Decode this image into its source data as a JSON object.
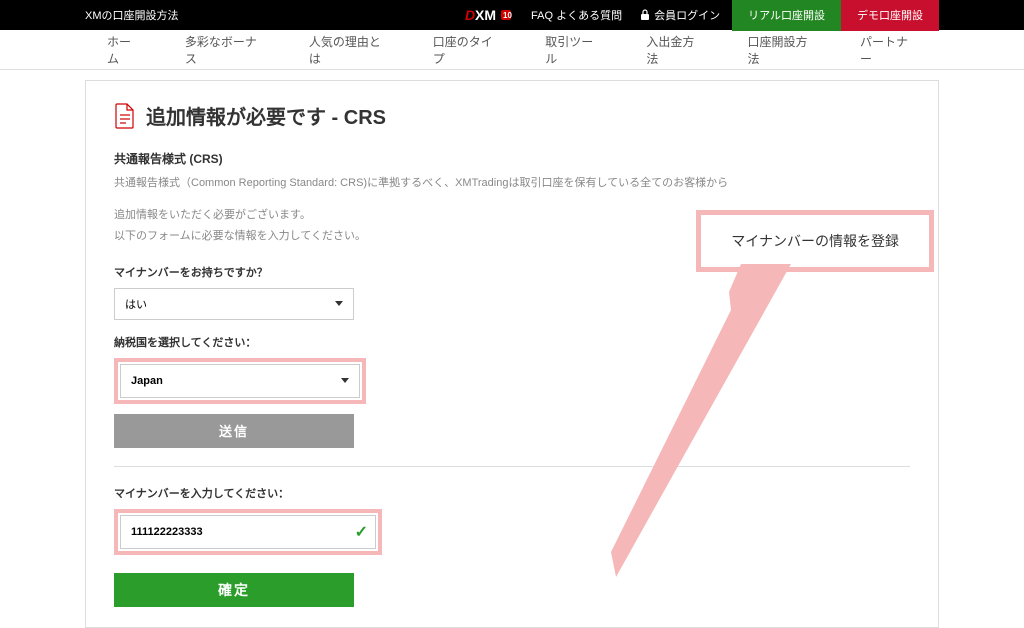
{
  "topbar": {
    "title": "XMの口座開設方法",
    "faq": "FAQ よくある質問",
    "login": "会員ログイン",
    "btn_real": "リアル口座開設",
    "btn_demo": "デモ口座開設"
  },
  "nav": {
    "items": [
      "ホーム",
      "多彩なボーナス",
      "人気の理由とは",
      "口座のタイプ",
      "取引ツール",
      "入出金方法",
      "口座開設方法",
      "パートナー"
    ]
  },
  "page": {
    "title": "追加情報が必要です - CRS",
    "section_title": "共通報告様式 (CRS)",
    "desc1": "共通報告様式（Common Reporting Standard: CRS)に準拠するべく、XMTradingは取引口座を保有している全てのお客様から",
    "desc2a": "追加情報をいただく必要がございます。",
    "desc2b": "以下のフォームに必要な情報を入力してください。"
  },
  "form": {
    "mynumber_q_label": "マイナンバーをお持ちですか？",
    "mynumber_q_value": "はい",
    "taxcountry_label": "納税国を選択してください：",
    "taxcountry_value": "Japan",
    "submit_label": "送信",
    "mynumber_input_label": "マイナンバーを入力してください：",
    "mynumber_input_value": "111122223333",
    "confirm_label": "確定"
  },
  "callout": {
    "text": "マイナンバーの情報を登録"
  }
}
